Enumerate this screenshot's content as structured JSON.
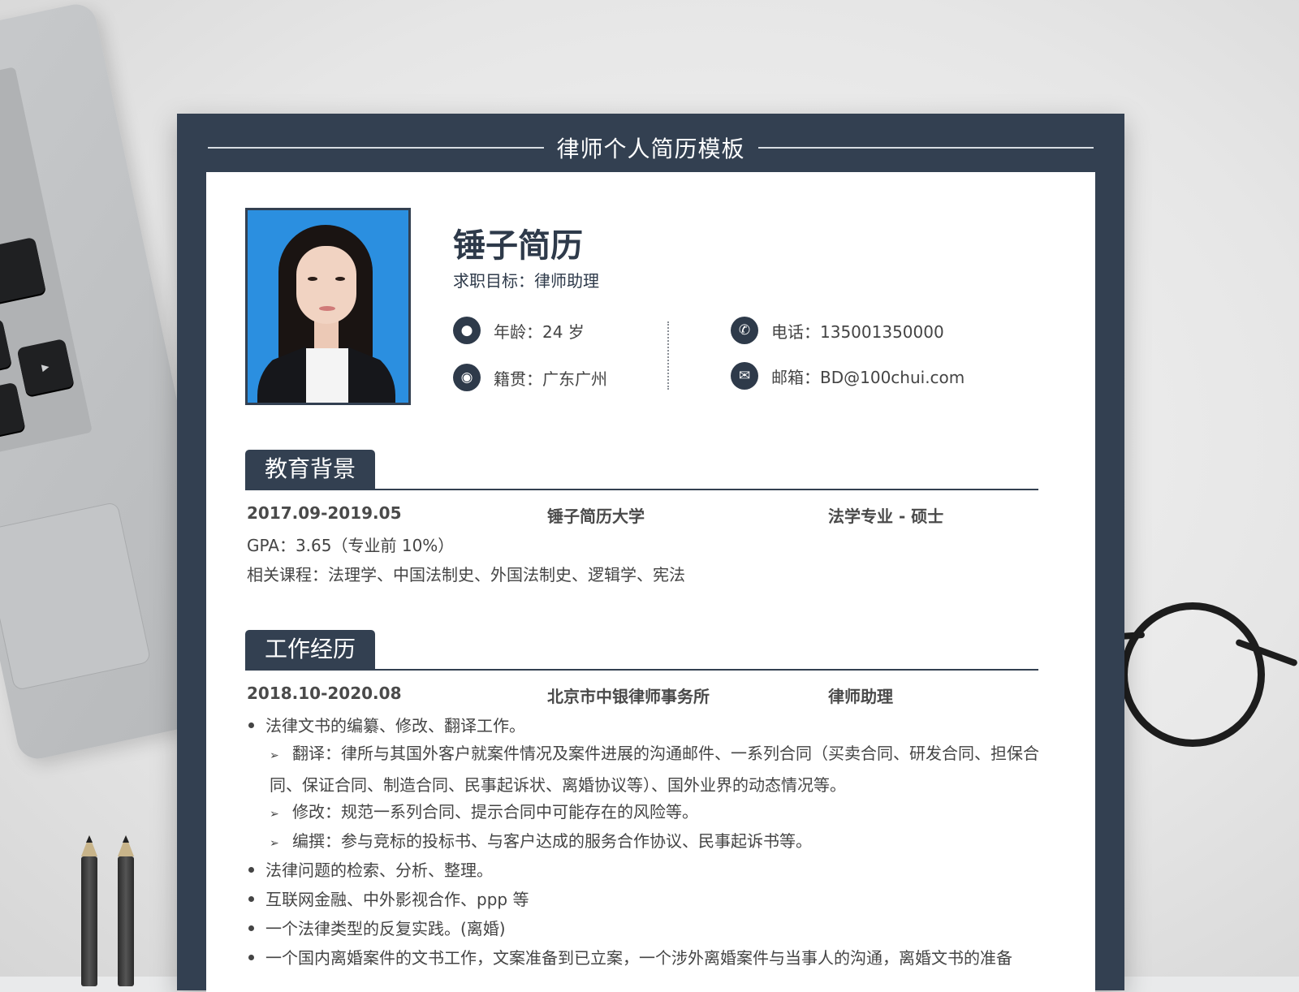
{
  "resume": {
    "header_title": "律师个人简历模板",
    "name": "锤子简历",
    "objective": "求职目标：律师助理",
    "info": {
      "age": "年龄：24 岁",
      "origin": "籍贯：广东广州",
      "phone": "电话：135001350000",
      "email": "邮箱：BD@100chui.com"
    },
    "education": {
      "title": "教育背景",
      "period": "2017.09-2019.05",
      "school": "锤子简历大学",
      "major": "法学专业 - 硕士",
      "gpa": "GPA：3.65（专业前 10%）",
      "courses": "相关课程：法理学、中国法制史、外国法制史、逻辑学、宪法"
    },
    "work": {
      "title": "工作经历",
      "period": "2018.10-2020.08",
      "company": "北京市中银律师事务所",
      "role": "律师助理",
      "bullets": [
        "法律文书的编纂、修改、翻译工作。",
        "法律问题的检索、分析、整理。",
        "互联网金融、中外影视合作、ppp 等",
        "一个法律类型的反复实践。(离婚)",
        "一个国内离婚案件的文书工作，文案准备到已立案，一个涉外离婚案件与当事人的沟通，离婚文书的准备"
      ],
      "subitems": [
        "翻译：律所与其国外客户就案件情况及案件进展的沟通邮件、一系列合同（买卖合同、研发合同、担保合同、保证合同、制造合同、民事起诉状、离婚协议等）、国外业界的动态情况等。",
        "修改：规范一系列合同、提示合同中可能存在的风险等。",
        "编撰：参与竞标的投标书、与客户达成的服务合作协议、民事起诉书等。"
      ]
    }
  },
  "icons": [
    "person-icon",
    "location-icon",
    "phone-icon",
    "mail-icon"
  ],
  "colors": {
    "navy": "#334051",
    "text": "#444444",
    "photo_bg": "#2b8fe0"
  }
}
